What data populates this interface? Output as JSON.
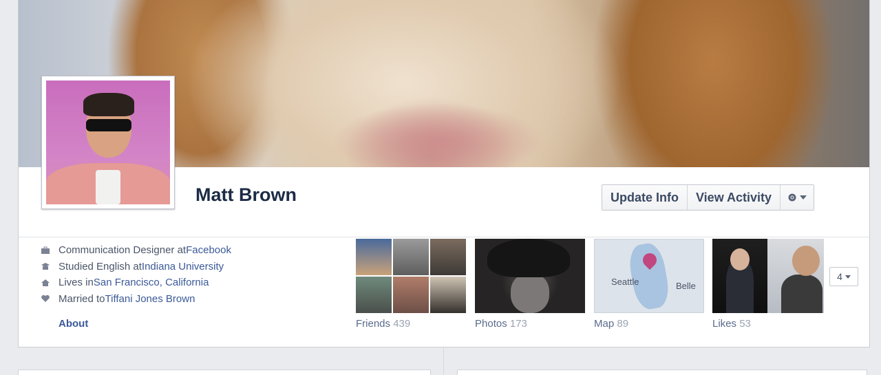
{
  "profile": {
    "name": "Matt Brown"
  },
  "actions": {
    "update_info": "Update Info",
    "view_activity": "View Activity",
    "settings_icon": "gear-icon"
  },
  "info": [
    {
      "icon": "briefcase-icon",
      "prefix": "Communication Designer at ",
      "link": "Facebook"
    },
    {
      "icon": "school-icon",
      "prefix": "Studied English at ",
      "link": "Indiana University"
    },
    {
      "icon": "home-icon",
      "prefix": "Lives in ",
      "link": "San Francisco, California"
    },
    {
      "icon": "heart-icon",
      "prefix": "Married to ",
      "link": "Tiffani Jones Brown"
    }
  ],
  "about_label": "About",
  "apps": {
    "friends": {
      "label": "Friends",
      "count": "439"
    },
    "photos": {
      "label": "Photos",
      "count": "173"
    },
    "map": {
      "label": "Map",
      "count": "89",
      "places": [
        "Seattle",
        "Belle"
      ]
    },
    "likes": {
      "label": "Likes",
      "count": "53"
    }
  },
  "more": {
    "label": "4"
  },
  "colors": {
    "link": "#3b5998",
    "name": "#1c2b45",
    "background": "#e9ebee"
  }
}
